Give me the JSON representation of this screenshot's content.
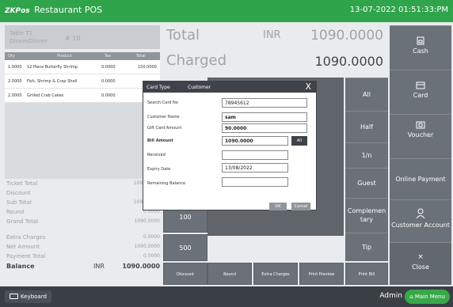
{
  "app": {
    "logo": "ZK",
    "title": "Restaurant POS",
    "logo_suffix": "Pos",
    "datetime": "13-07-2022 01:51:33:PM"
  },
  "order": {
    "header_line1": "Table T1",
    "header_line2": "Dinein/Dinner",
    "header_ticket": "# 10",
    "columns": [
      "Qty",
      "Product",
      "Tax",
      "Total"
    ],
    "items": [
      {
        "qty": "1.0000",
        "product": "12 Piece Butterfly Shrimp",
        "tax": "0.0000",
        "total": "150.0000"
      },
      {
        "qty": "2.0000",
        "product": "Fish, Shrimp & Crap Shell",
        "tax": "0.0000",
        "total": ""
      },
      {
        "qty": "2.0000",
        "product": "Grilled Crab Cakes",
        "tax": "0.0000",
        "total": ""
      }
    ]
  },
  "totals": {
    "ticket_total_label": "Ticket Total",
    "ticket_total_value": "1090",
    "discount_label": "Discount",
    "subtotal_label": "Sub Total",
    "subtotal_value": "1090",
    "round_label": "Round",
    "round_value": "0.0000",
    "grand_total_label": "Grand Total",
    "grand_total_value": "1090.0000",
    "extra_charges_label": "Extra Charges",
    "extra_charges_value": "0.0000",
    "net_amount_label": "Net Amount",
    "net_amount_value": "1090.0000",
    "payment_total_label": "Payment Total",
    "payment_total_value": "0.0000",
    "balance_label": "Balance",
    "balance_currency": "INR",
    "balance_value": "1090.0000"
  },
  "summary": {
    "total_label": "Total",
    "currency": "INR",
    "total_value": "1090.0000",
    "charged_label": "Charged",
    "charged_value": "1090.0000"
  },
  "center_buttons": {
    "b100": "100",
    "b500": "500",
    "discount": "Discount",
    "round": "Round",
    "extra_charges": "Extra Charges",
    "print_preview": "Print Preview",
    "print_bill": "Print Bill"
  },
  "side_buttons": [
    "All",
    "Half",
    "1/n",
    "Guest",
    "Complementary",
    "Tip"
  ],
  "side_button_labels": {
    "all": "All",
    "half": "Half",
    "n": "1/n",
    "guest": "Guest",
    "comp1": "Complemen",
    "comp2": "tary",
    "tip": "Tip"
  },
  "right_buttons": {
    "cash": "Cash",
    "card": "Card",
    "voucher": "Voucher",
    "online": "Online Payment",
    "customer": "Customer Account",
    "close": "Close"
  },
  "dialog": {
    "tab1": "Card Type",
    "tab2": "Customer",
    "close": "X",
    "search_card_label": "Search Card No",
    "search_card_value": "78945612",
    "customer_name_label": "Customer Name",
    "customer_name_value": "sam",
    "gift_amount_label": "Gift Card Amount",
    "gift_amount_value": "90.0000",
    "bill_amount_label": "Bill Amount",
    "bill_amount_value": "1090.0000",
    "all_button": "All",
    "received_label": "Received",
    "received_value": "",
    "expiry_label": "Expiry Date",
    "expiry_value": "13/08/2022",
    "remaining_label": "Remaining Balance",
    "remaining_value": "",
    "ok": "OK",
    "cancel": "Cancel"
  },
  "footer": {
    "keyboard": "Keyboard",
    "user": "Admin",
    "main_menu": "Main Menu"
  },
  "colors": {
    "brand_green": "#2fa44b",
    "button_gray": "#6b7178",
    "dark": "#3d4349"
  }
}
